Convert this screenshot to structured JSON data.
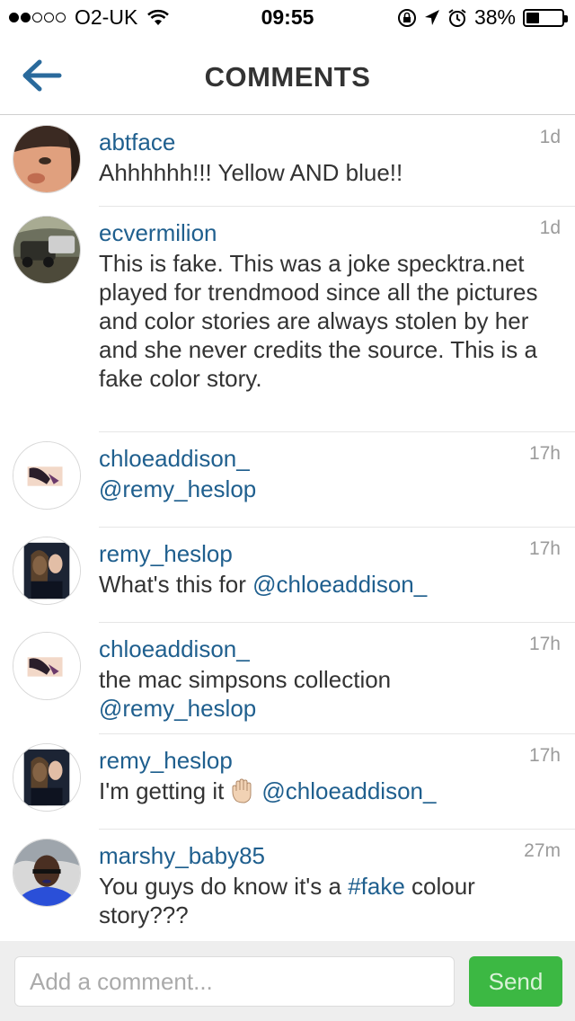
{
  "status_bar": {
    "carrier": "O2-UK",
    "time": "09:55",
    "battery": "38%",
    "battery_level": 0.38,
    "signal_bars_filled": 2,
    "signal_bars_total": 5
  },
  "header": {
    "title": "COMMENTS",
    "back_icon": "back-arrow-icon",
    "accent_color": "#1f5f8e"
  },
  "comments": [
    {
      "username": "abtface",
      "time": "1d",
      "text": "Ahhhhhh!!! Yellow AND blue!!"
    },
    {
      "username": "ecvermilion",
      "time": "1d",
      "text": "This is fake.  This was a joke specktra.net played for trendmood since all the pictures and color stories are always stolen by her and she never credits the source.  This is a fake color story."
    },
    {
      "username": "chloeaddison_",
      "time": "17h",
      "mention": "@remy_heslop"
    },
    {
      "username": "remy_heslop",
      "time": "17h",
      "text": "What's this for ",
      "mention": "@chloeaddison_"
    },
    {
      "username": "chloeaddison_",
      "time": "17h",
      "text": "the mac simpsons collection",
      "mention": "@remy_heslop"
    },
    {
      "username": "remy_heslop",
      "time": "17h",
      "text": "I'm getting it",
      "emoji": "raised-hand-icon",
      "mention": "@chloeaddison_"
    },
    {
      "username": "marshy_baby85",
      "time": "27m",
      "text_before": "You guys do know it's a ",
      "hashtag": "#fake",
      "text_after": " colour story???"
    }
  ],
  "composer": {
    "placeholder": "Add a comment...",
    "value": "",
    "send_label": "Send",
    "send_color": "#3cb843"
  }
}
